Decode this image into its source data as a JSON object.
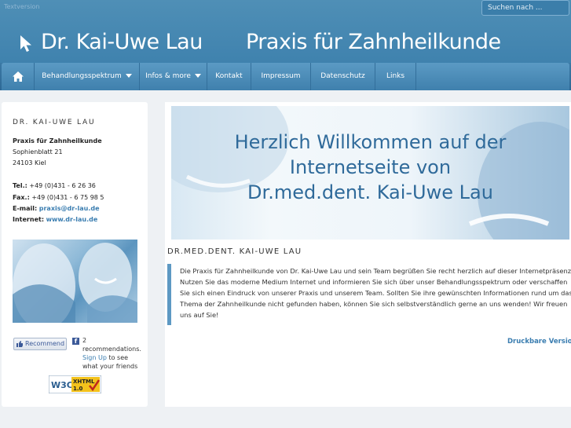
{
  "header": {
    "text_version": "Textversion",
    "search_placeholder": "Suchen nach ...",
    "site_name": "Dr. Kai-Uwe Lau",
    "site_subtitle": "Praxis für Zahnheilkunde"
  },
  "nav": {
    "items": [
      {
        "label": "Behandlungsspektrum",
        "dropdown": true
      },
      {
        "label": "Infos & more",
        "dropdown": true
      },
      {
        "label": "Kontakt",
        "dropdown": false
      },
      {
        "label": "Impressum",
        "dropdown": false
      },
      {
        "label": "Datenschutz",
        "dropdown": false
      },
      {
        "label": "Links",
        "dropdown": false
      }
    ]
  },
  "sidebar": {
    "title": "DR. KAI-UWE LAU",
    "practice": "Praxis für Zahnheilkunde",
    "street": "Sophienblatt 21",
    "city": "24103 Kiel",
    "tel_label": "Tel.:",
    "tel": "+49 (0)431 - 6 26 36",
    "fax_label": "Fax.:",
    "fax": "+49 (0)431 - 6 75 98 5",
    "email_label": "E-mail:",
    "email": "praxis@dr-lau.de",
    "internet_label": "Internet:",
    "internet": "www.dr-lau.de",
    "recommend_label": "Recommend",
    "fb_count": "2",
    "fb_text": "recommendations.",
    "fb_signup": "Sign Up",
    "fb_signup_rest": "to see",
    "fb_line4": "what your friends",
    "w3c_label": "W3C",
    "xhtml_label": "XHTML",
    "xhtml_version": "1.0"
  },
  "main": {
    "banner_line1": "Herzlich Willkommen auf der",
    "banner_line2": "Internetseite von",
    "banner_line3": "Dr.med.dent. Kai-Uwe Lau",
    "article_title": "DR.MED.DENT. KAI-UWE LAU",
    "article_line1": "Die Praxis für Zahnheilkunde von Dr. Kai-Uwe Lau und sein Team begrüßen Sie recht herzlich auf dieser Internetpräsenz.",
    "article_line2": "Nutzen Sie das moderne Medium Internet und informieren Sie sich über unser Behandlungsspektrum oder verschaffen",
    "article_line3": "Sie sich einen Eindruck von unserer Praxis und unserem Team. Sollten Sie ihre gewünschten Informationen rund um das",
    "article_line4": "Thema der Zahnheilkunde nicht gefunden haben, können Sie sich selbstverständlich gerne an uns wenden! Wir freuen",
    "article_line5": "uns auf Sie!",
    "print_link": "Druckbare Version"
  },
  "colors": {
    "header_blue": "#4f8fb6",
    "nav_blue": "#3f80ad",
    "accent": "#3a7db0",
    "quote_bar": "#5d99c3"
  }
}
